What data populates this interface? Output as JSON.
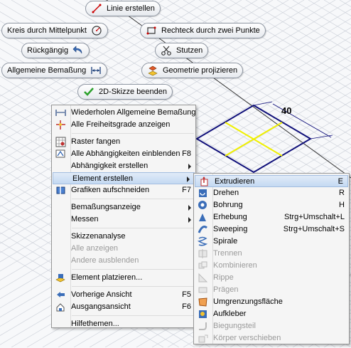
{
  "pills": {
    "line": "Linie erstellen",
    "circle": "Kreis durch Mittelpunkt",
    "rect": "Rechteck durch zwei Punkte",
    "undo": "Rückgängig",
    "trim": "Stutzen",
    "dimension": "Allgemeine Bemaßung",
    "project": "Geometrie projizieren",
    "finish": "2D-Skizze beenden"
  },
  "canvas": {
    "dimension_value": "40"
  },
  "context_menu": {
    "repeat": "Wiederholen Allgemeine Bemaßung",
    "show_dof": "Alle Freiheitsgrade anzeigen",
    "snap_grid": "Raster fangen",
    "show_constraints": "Alle Abhängigkeiten einblenden",
    "show_constraints_shortcut": "F8",
    "create_constraint": "Abhängigkeit erstellen",
    "create_feature": "Element erstellen",
    "slice_graphics": "Grafiken aufschneiden",
    "slice_graphics_shortcut": "F7",
    "dimension_display": "Bemaßungsanzeige",
    "measure": "Messen",
    "sketch_analysis": "Skizzenanalyse",
    "show_all": "Alle anzeigen",
    "hide_others": "Andere ausblenden",
    "place_feature": "Element platzieren...",
    "previous_view": "Vorherige Ansicht",
    "previous_view_shortcut": "F5",
    "home_view": "Ausgangsansicht",
    "home_view_shortcut": "F6",
    "help_topics": "Hilfethemen..."
  },
  "submenu": [
    {
      "name": "extrude",
      "label": "Extrudieren",
      "shortcut": "E",
      "enabled": true,
      "highlighted": true,
      "icon": "extrude-icon"
    },
    {
      "name": "revolve",
      "label": "Drehen",
      "shortcut": "R",
      "enabled": true,
      "icon": "revolve-icon"
    },
    {
      "name": "hole",
      "label": "Bohrung",
      "shortcut": "H",
      "enabled": true,
      "icon": "hole-icon"
    },
    {
      "name": "emboss",
      "label": "Erhebung",
      "shortcut": "Strg+Umschalt+L",
      "enabled": true,
      "icon": "loft-icon"
    },
    {
      "name": "sweep",
      "label": "Sweeping",
      "shortcut": "Strg+Umschalt+S",
      "enabled": true,
      "icon": "sweep-icon"
    },
    {
      "name": "coil",
      "label": "Spirale",
      "shortcut": "",
      "enabled": true,
      "icon": "coil-icon"
    },
    {
      "name": "split",
      "label": "Trennen",
      "shortcut": "",
      "enabled": false,
      "icon": "split-icon"
    },
    {
      "name": "combine",
      "label": "Kombinieren",
      "shortcut": "",
      "enabled": false,
      "icon": "combine-icon"
    },
    {
      "name": "rib",
      "label": "Rippe",
      "shortcut": "",
      "enabled": false,
      "icon": "rib-icon"
    },
    {
      "name": "emboss-text",
      "label": "Prägen",
      "shortcut": "",
      "enabled": false,
      "icon": "emboss-icon"
    },
    {
      "name": "boundary-patch",
      "label": "Umgrenzungsfläche",
      "shortcut": "",
      "enabled": true,
      "icon": "boundary-patch-icon"
    },
    {
      "name": "decal",
      "label": "Aufkleber",
      "shortcut": "",
      "enabled": true,
      "icon": "decal-icon"
    },
    {
      "name": "bend-part",
      "label": "Biegungsteil",
      "shortcut": "",
      "enabled": false,
      "icon": "bend-part-icon"
    },
    {
      "name": "move-bodies",
      "label": "Körper verschieben",
      "shortcut": "",
      "enabled": false,
      "icon": "move-bodies-icon"
    }
  ],
  "colors": {
    "sketch_blue": "#10107a",
    "sketch_yellow": "#f0f000",
    "grid": "#d0d4dc",
    "highlight": "#c4d9f2"
  }
}
